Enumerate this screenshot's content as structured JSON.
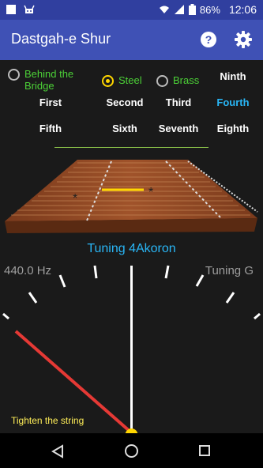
{
  "status": {
    "battery": "86%",
    "time": "12:06"
  },
  "app": {
    "title": "Dastgah-e Shur"
  },
  "radios": [
    {
      "label": "Behind the\nBridge",
      "selected": false
    },
    {
      "label": "Steel",
      "selected": true
    },
    {
      "label": "Brass",
      "selected": false
    }
  ],
  "octaves": [
    "Ninth",
    "First",
    "Second",
    "Third",
    "Fourth",
    "Fifth",
    "Sixth",
    "Seventh",
    "Eighth"
  ],
  "selected_octave": "Fourth",
  "tuning": {
    "label": "Tuning 4Akoron",
    "frequency": "440.0 Hz",
    "note": "Tuning G",
    "hint": "Tighten the string"
  },
  "colors": {
    "accent": "#29b6f6",
    "green": "#4cd137",
    "yellow": "#ffee58",
    "needle": "#e53935"
  }
}
